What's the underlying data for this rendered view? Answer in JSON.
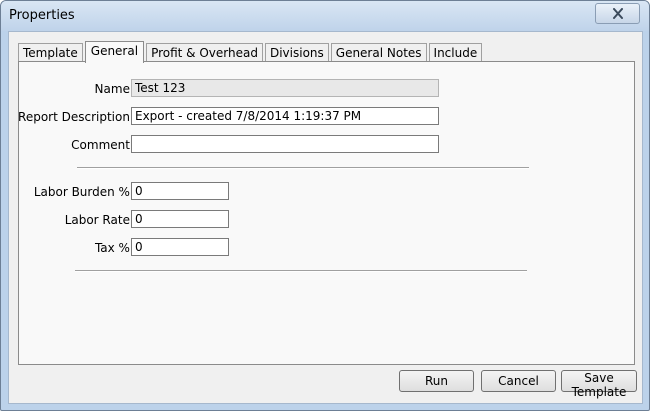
{
  "window": {
    "title": "Properties"
  },
  "tabs": [
    {
      "label": "Template"
    },
    {
      "label": "General"
    },
    {
      "label": "Profit & Overhead"
    },
    {
      "label": "Divisions"
    },
    {
      "label": "General Notes"
    },
    {
      "label": "Include"
    }
  ],
  "active_tab": "General",
  "form": {
    "name": {
      "label": "Name:",
      "value": "Test 123"
    },
    "report_description": {
      "label": "Report Description:",
      "value": "Export - created 7/8/2014 1:19:37 PM"
    },
    "comment": {
      "label": "Comment:",
      "value": ""
    },
    "labor_burden": {
      "label": "Labor Burden %:",
      "value": "0"
    },
    "labor_rate": {
      "label": "Labor Rate:",
      "value": "0"
    },
    "tax": {
      "label": "Tax %:",
      "value": "0"
    }
  },
  "buttons": {
    "run": "Run",
    "cancel": "Cancel",
    "save_template": "Save Template"
  },
  "icons": {
    "close": "close-icon"
  }
}
